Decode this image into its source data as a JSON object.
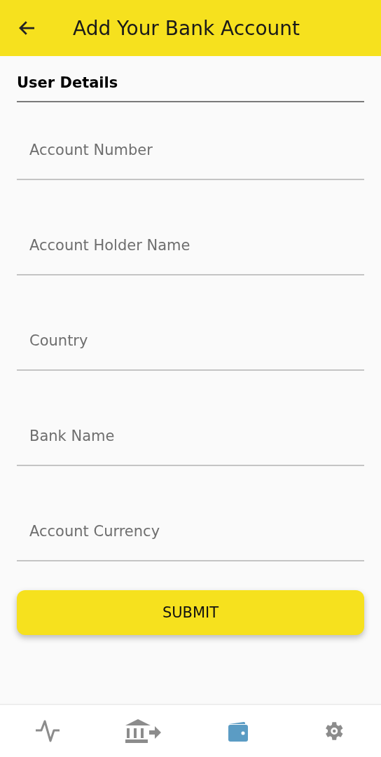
{
  "header": {
    "title": "Add Your Bank Account"
  },
  "section": {
    "title": "User Details"
  },
  "fields": [
    {
      "placeholder": "Account Number"
    },
    {
      "placeholder": "Account Holder Name"
    },
    {
      "placeholder": "Country"
    },
    {
      "placeholder": "Bank Name"
    },
    {
      "placeholder": "Account Currency"
    }
  ],
  "submit": {
    "label": "SUBMIT"
  },
  "nav": [
    {
      "kind": "activity",
      "selected": false
    },
    {
      "kind": "bank",
      "selected": false
    },
    {
      "kind": "wallet",
      "selected": true
    },
    {
      "kind": "settings",
      "selected": false
    }
  ]
}
